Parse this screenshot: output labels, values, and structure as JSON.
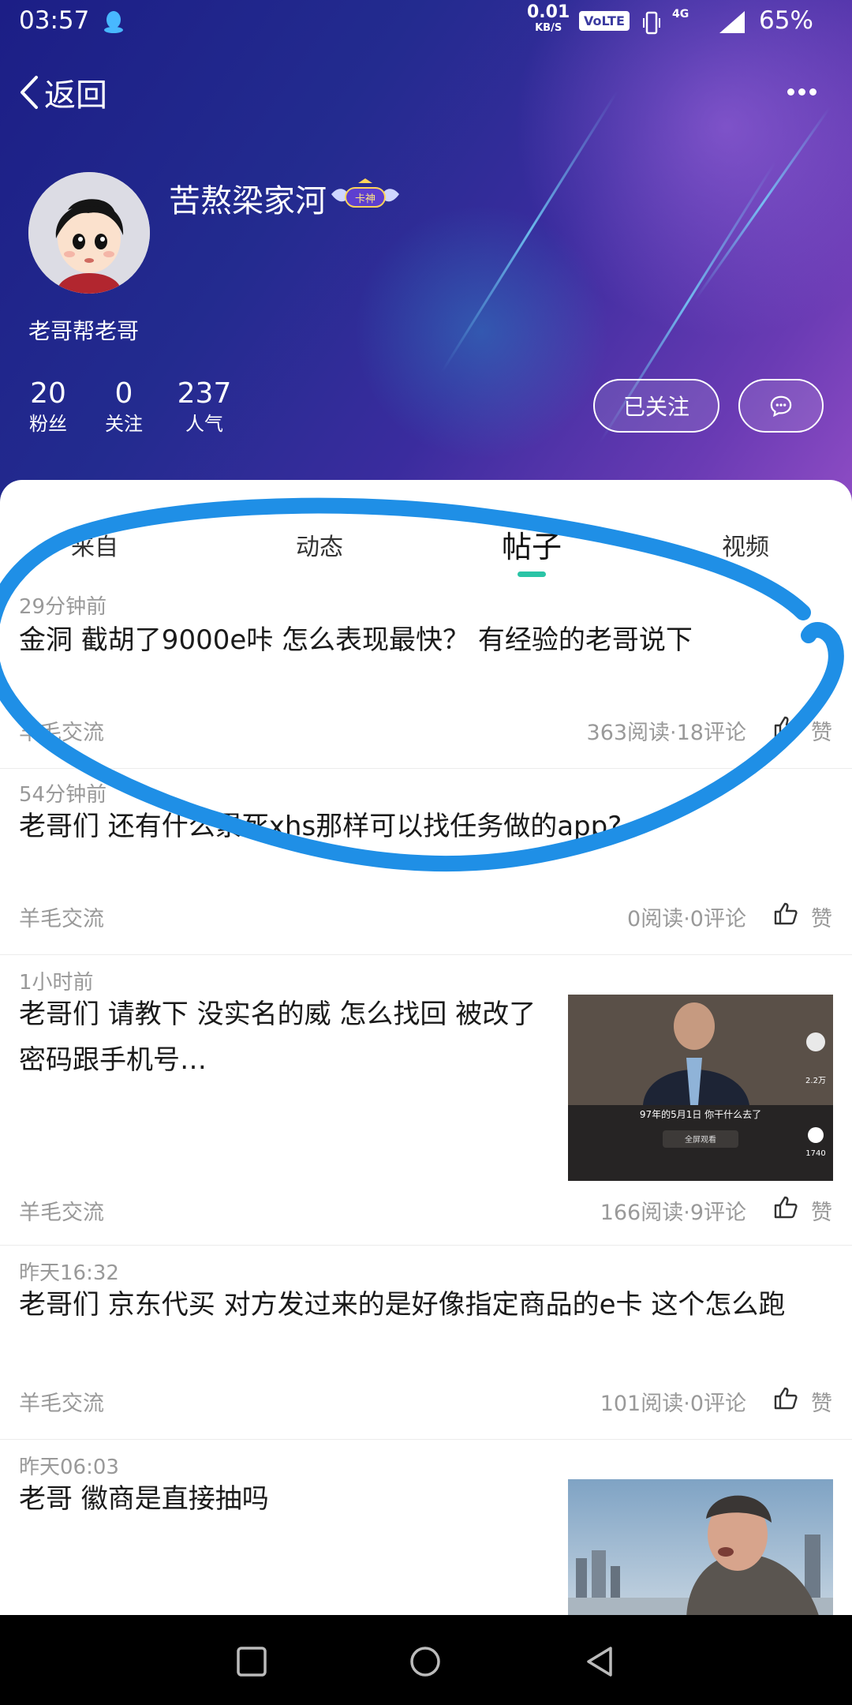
{
  "status_bar": {
    "time": "03:57",
    "speed_value": "0.01",
    "speed_unit": "KB/S",
    "volte": "VoLTE",
    "network": "4G",
    "battery": "65%"
  },
  "header": {
    "back_label": "返回",
    "username": "苦熬梁家河",
    "badge_text": "卡神",
    "signature": "老哥帮老哥",
    "stats": [
      {
        "value": "20",
        "label": "粉丝"
      },
      {
        "value": "0",
        "label": "关注"
      },
      {
        "value": "237",
        "label": "人气"
      }
    ],
    "follow_button": "已关注"
  },
  "tabs": [
    {
      "label": "来自",
      "active": false
    },
    {
      "label": "动态",
      "active": false
    },
    {
      "label": "帖子",
      "active": true
    },
    {
      "label": "视频",
      "active": false
    }
  ],
  "posts": [
    {
      "time": "29分钟前",
      "title": "金洞 截胡了9000e咔 怎么表现最快？ 有经验的老哥说下",
      "category": "羊毛交流",
      "meta": "363阅读·18评论",
      "like": "赞",
      "thumb": ""
    },
    {
      "time": "54分钟前",
      "title": "老哥们 还有什么累死xhs那样可以找任务做的app?",
      "category": "羊毛交流",
      "meta": "0阅读·0评论",
      "like": "赞",
      "thumb": ""
    },
    {
      "time": "1小时前",
      "title": "老哥们 请教下 没实名的威 怎么找回 被改了密码跟手机号…",
      "category": "羊毛交流",
      "meta": "166阅读·9评论",
      "like": "赞",
      "thumb": "video-screenshot",
      "thumb_caption": "97年的5月1日 你干什么去了",
      "thumb_button": "全屏观看",
      "thumb_count1": "2.2万",
      "thumb_count2": "1740"
    },
    {
      "time": "昨天16:32",
      "title": "老哥们 京东代买 对方发过来的是好像指定商品的e卡 这个怎么跑",
      "category": "羊毛交流",
      "meta": "101阅读·0评论",
      "like": "赞",
      "thumb": ""
    },
    {
      "time": "昨天06:03",
      "title": "老哥 徽商是直接抽吗",
      "category": "",
      "meta": "",
      "like": "",
      "thumb": "photo-man-city"
    }
  ],
  "colors": {
    "tab_indicator": "#2bc4a6",
    "annotation": "#1f8fe6"
  }
}
